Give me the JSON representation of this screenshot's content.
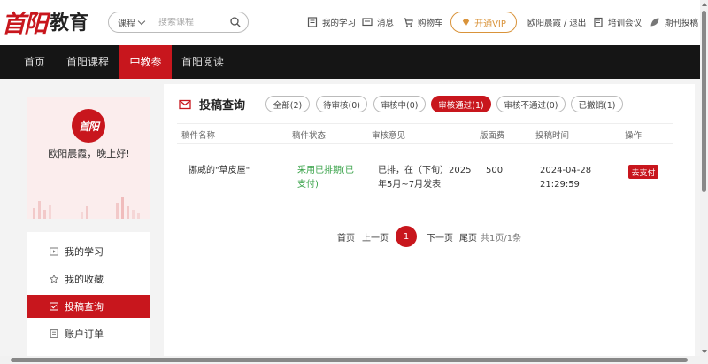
{
  "header": {
    "logo_mark": "首阳",
    "logo_text": "教育",
    "search": {
      "category": "课程",
      "placeholder": "搜索课程"
    },
    "links": {
      "my_study": "我的学习",
      "messages": "消息",
      "cart": "购物车",
      "vip": "开通VIP",
      "user": "欧阳晨霞 / 退出",
      "training": "培训会议",
      "journal": "期刊投稿"
    }
  },
  "mainnav": [
    "首页",
    "首阳课程",
    "中教参",
    "首阳阅读"
  ],
  "profile": {
    "avatar": "首阳",
    "greeting": "欧阳晨霞，晚上好!"
  },
  "menu": [
    "我的学习",
    "我的收藏",
    "投稿查询",
    "账户订单"
  ],
  "panel": {
    "title": "投稿查询",
    "filters": [
      "全部(2)",
      "待审核(0)",
      "审核中(0)",
      "审核通过(1)",
      "审核不通过(0)",
      "已撤销(1)"
    ],
    "columns": [
      "稿件名称",
      "稿件状态",
      "审核意见",
      "版面费",
      "投稿时间",
      "操作"
    ],
    "rows": [
      {
        "name": "挪威的\"草皮屋\"",
        "status_line1": "采用已排期(已",
        "status_line2": "支付)",
        "opinion_line1": "已排，在（下旬）2025",
        "opinion_line2": "年5月~7月发表",
        "fee": "500",
        "date": "2024-04-28",
        "time": "21:29:59",
        "action": "去支付"
      }
    ],
    "pager": {
      "first": "首页",
      "prev": "上一页",
      "current": "1",
      "next": "下一页",
      "last": "尾页",
      "summary": "共1页/1条"
    }
  },
  "colors": {
    "accent": "#c8161d",
    "nav_bg": "#151515",
    "vip": "#d9933a",
    "status": "#3aa34a"
  }
}
